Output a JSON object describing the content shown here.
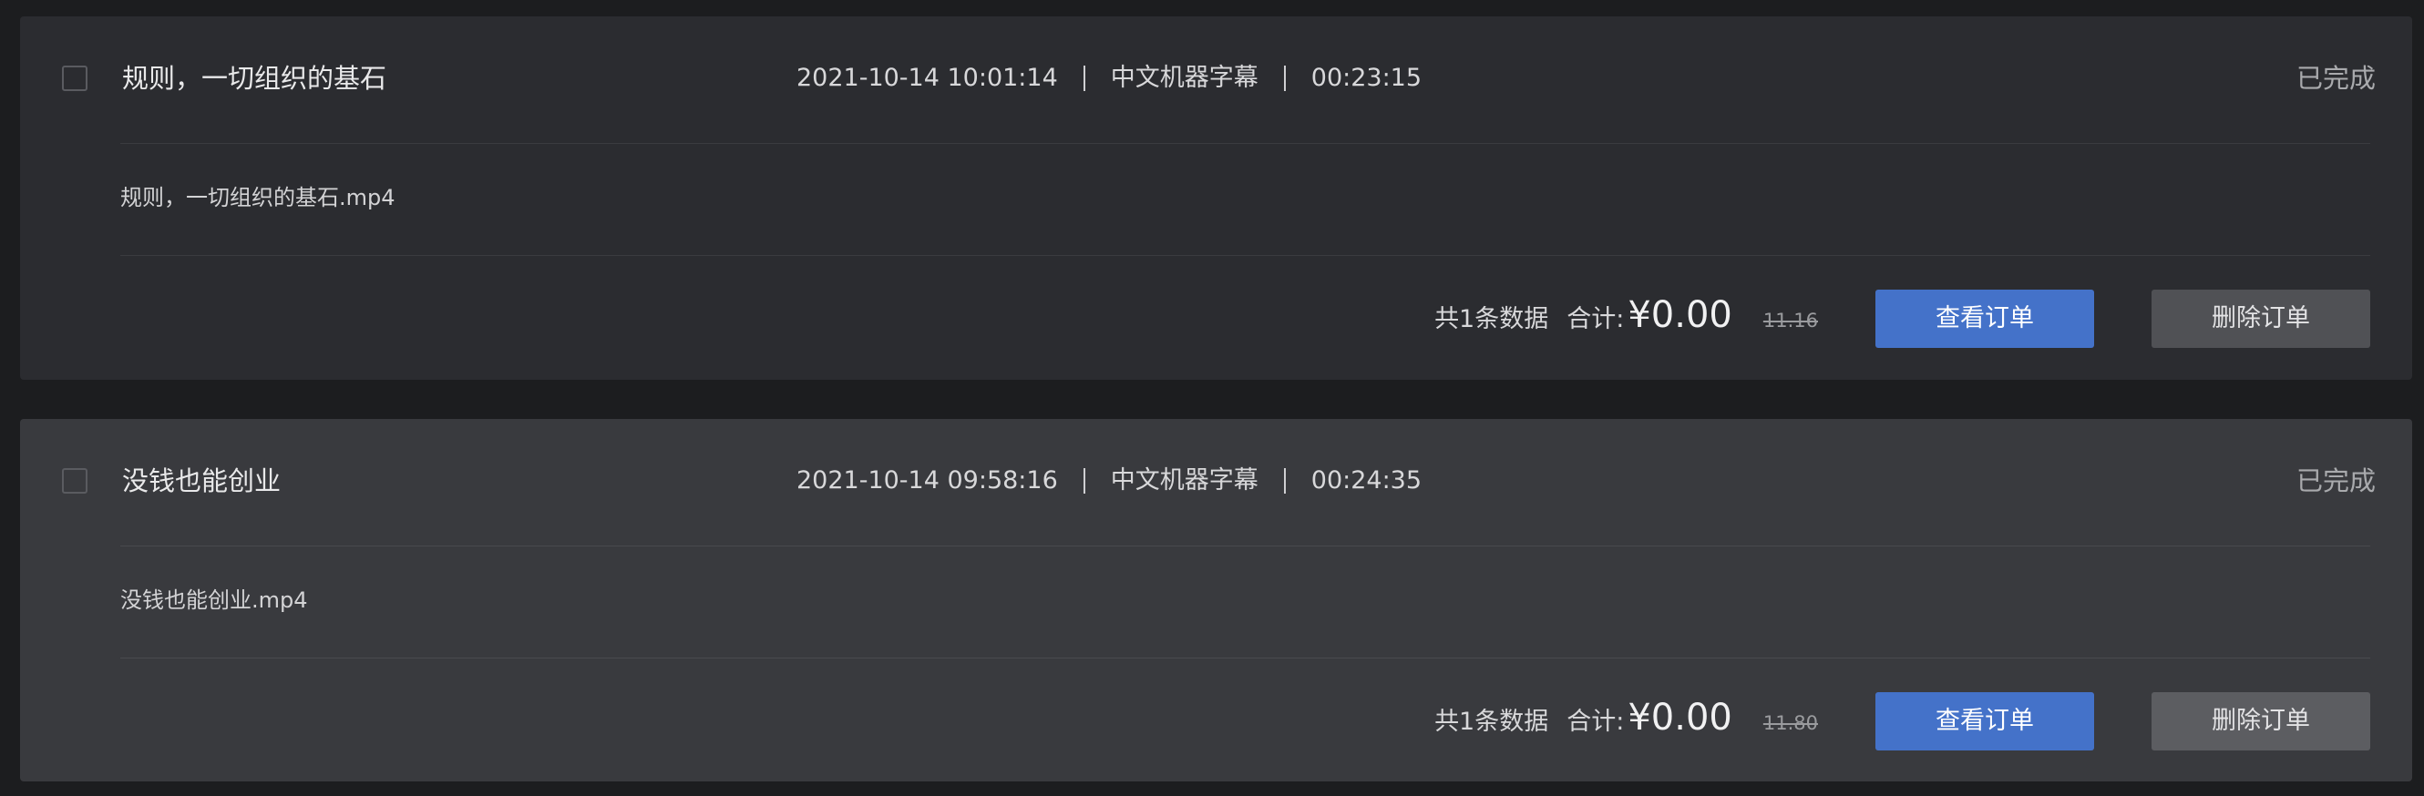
{
  "orders": [
    {
      "title": "规则，一切组织的基石",
      "datetime": "2021-10-14 10:01:14",
      "subtitle_type": "中文机器字幕",
      "duration": "00:23:15",
      "status": "已完成",
      "file_name": "规则，一切组织的基石.mp4",
      "count_text": "共1条数据",
      "total_label": "合计:",
      "price": "¥0.00",
      "original_price": "11.16",
      "view_button": "查看订单",
      "delete_button": "删除订单",
      "checked": false
    },
    {
      "title": "没钱也能创业",
      "datetime": "2021-10-14 09:58:16",
      "subtitle_type": "中文机器字幕",
      "duration": "00:24:35",
      "status": "已完成",
      "file_name": "没钱也能创业.mp4",
      "count_text": "共1条数据",
      "total_label": "合计:",
      "price": "¥0.00",
      "original_price": "11.80",
      "view_button": "查看订单",
      "delete_button": "删除订单",
      "checked": false
    }
  ],
  "colors": {
    "page_background": "#1c1d1f",
    "card_background": "#2b2c30",
    "card_background_hover": "#393a3e",
    "primary_button": "#4472c9",
    "secondary_button": "#505155"
  }
}
